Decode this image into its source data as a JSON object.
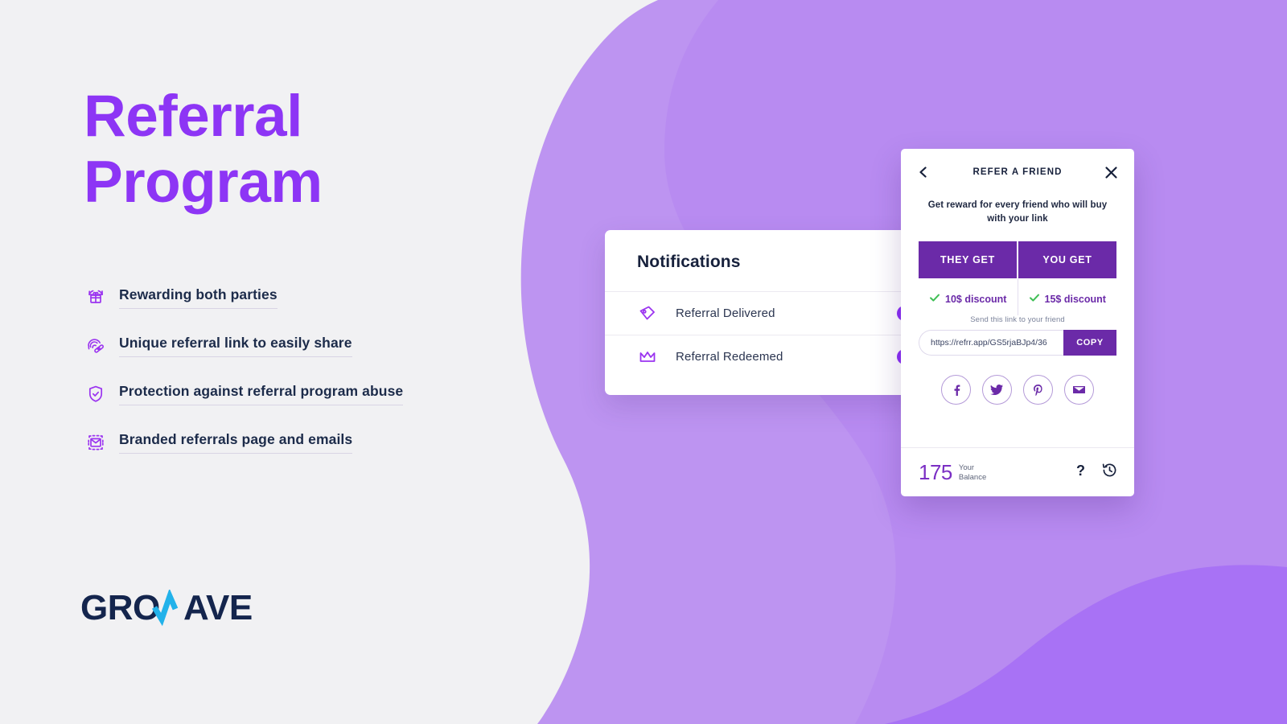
{
  "page": {
    "background_color": "#f1f1f3",
    "accent_purple": "#8d35f5",
    "wave_light": "#b98df0",
    "wave_main": "#a872f5",
    "deep_purple": "#6b2aa8",
    "navy": "#17213c"
  },
  "hero": {
    "title_line1": "Referral",
    "title_line2": "Program"
  },
  "features": [
    {
      "icon": "gift-refresh-icon",
      "label": "Rewarding both parties"
    },
    {
      "icon": "fingerprint-link-icon",
      "label": "Unique referral link to easily share"
    },
    {
      "icon": "shield-check-icon",
      "label": "Protection against referral program abuse"
    },
    {
      "icon": "envelope-frame-icon",
      "label": "Branded referrals page and emails"
    }
  ],
  "logo": {
    "text_part1": "GRO",
    "text_part2": "W",
    "text_part3": "AVE",
    "full": "GROWAVE",
    "dark_color": "#14254d",
    "accent_color": "#22b2ea"
  },
  "notifications_card": {
    "title": "Notifications",
    "rows": [
      {
        "icon": "tag-icon",
        "label": "Referral Delivered",
        "toggle_on": true
      },
      {
        "icon": "crown-icon",
        "label": "Referral Redeemed",
        "toggle_on": true
      }
    ]
  },
  "refer_widget": {
    "header": {
      "back_icon": "chevron-left-icon",
      "title": "REFER A FRIEND",
      "close_icon": "close-icon"
    },
    "subtitle": "Get reward for every friend who will buy with your link",
    "tabs": [
      {
        "label": "THEY GET"
      },
      {
        "label": "YOU GET"
      }
    ],
    "rewards": [
      {
        "check_icon": "check-icon",
        "label": "10$ discount"
      },
      {
        "check_icon": "check-icon",
        "label": "15$ discount"
      }
    ],
    "link_caption": "Send this link to your friend",
    "link_value": "https://refrr.app/GS5rjaBJp4/36",
    "copy_label": "COPY",
    "socials": [
      {
        "icon": "facebook-icon",
        "name": "Facebook"
      },
      {
        "icon": "twitter-icon",
        "name": "Twitter"
      },
      {
        "icon": "pinterest-icon",
        "name": "Pinterest"
      },
      {
        "icon": "email-icon",
        "name": "Email"
      }
    ],
    "footer": {
      "balance_value": "175",
      "balance_label_line1": "Your",
      "balance_label_line2": "Balance",
      "help_icon": "question-mark-icon",
      "history_icon": "history-clock-icon"
    }
  }
}
